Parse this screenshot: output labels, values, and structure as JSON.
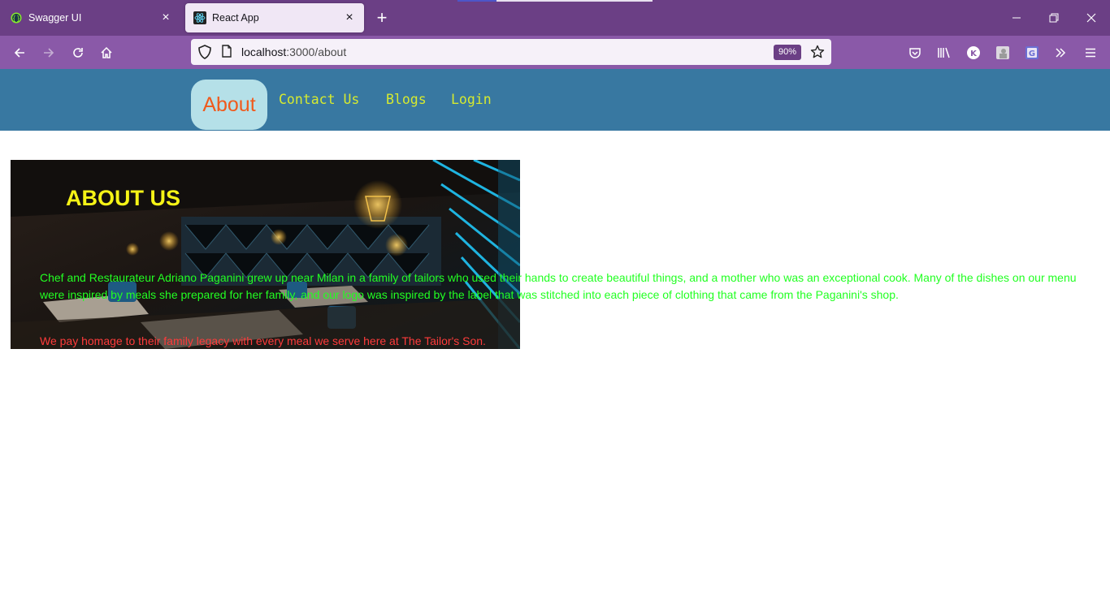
{
  "browser": {
    "tabs": [
      {
        "title": "Swagger UI",
        "favicon": "swagger-icon",
        "active": false
      },
      {
        "title": "React App",
        "favicon": "react-icon",
        "active": true
      }
    ],
    "url_host": "localhost",
    "url_path": ":3000/about",
    "zoom": "90%"
  },
  "nav": {
    "about": "About",
    "contact": "Contact Us",
    "blogs": "Blogs",
    "login": "Login"
  },
  "about": {
    "title": "ABOUT US",
    "paragraph": "Chef and Restaurateur Adriano Paganini grew up near Milan in a family of tailors who used their hands to create beautiful things, and a mother who was an exceptional cook. Many of the dishes on our menu were inspired by meals she prepared for her family, and our logo was inspired by the label that was stitched into each piece of clothing that came from the Paganini's shop.",
    "legacy": "We pay homage to their family legacy with every meal we serve here at The Tailor's Son."
  },
  "colors": {
    "tab_strip": "#6b3f85",
    "toolbar": "#8a59a8",
    "header": "#3878a1",
    "about_pill": "#b5e0e8",
    "about_text": "#f05a1c",
    "nav_link": "#d6ea2f",
    "title": "#f5f316",
    "paragraph": "#22ff22",
    "legacy": "#ff3b3b"
  }
}
